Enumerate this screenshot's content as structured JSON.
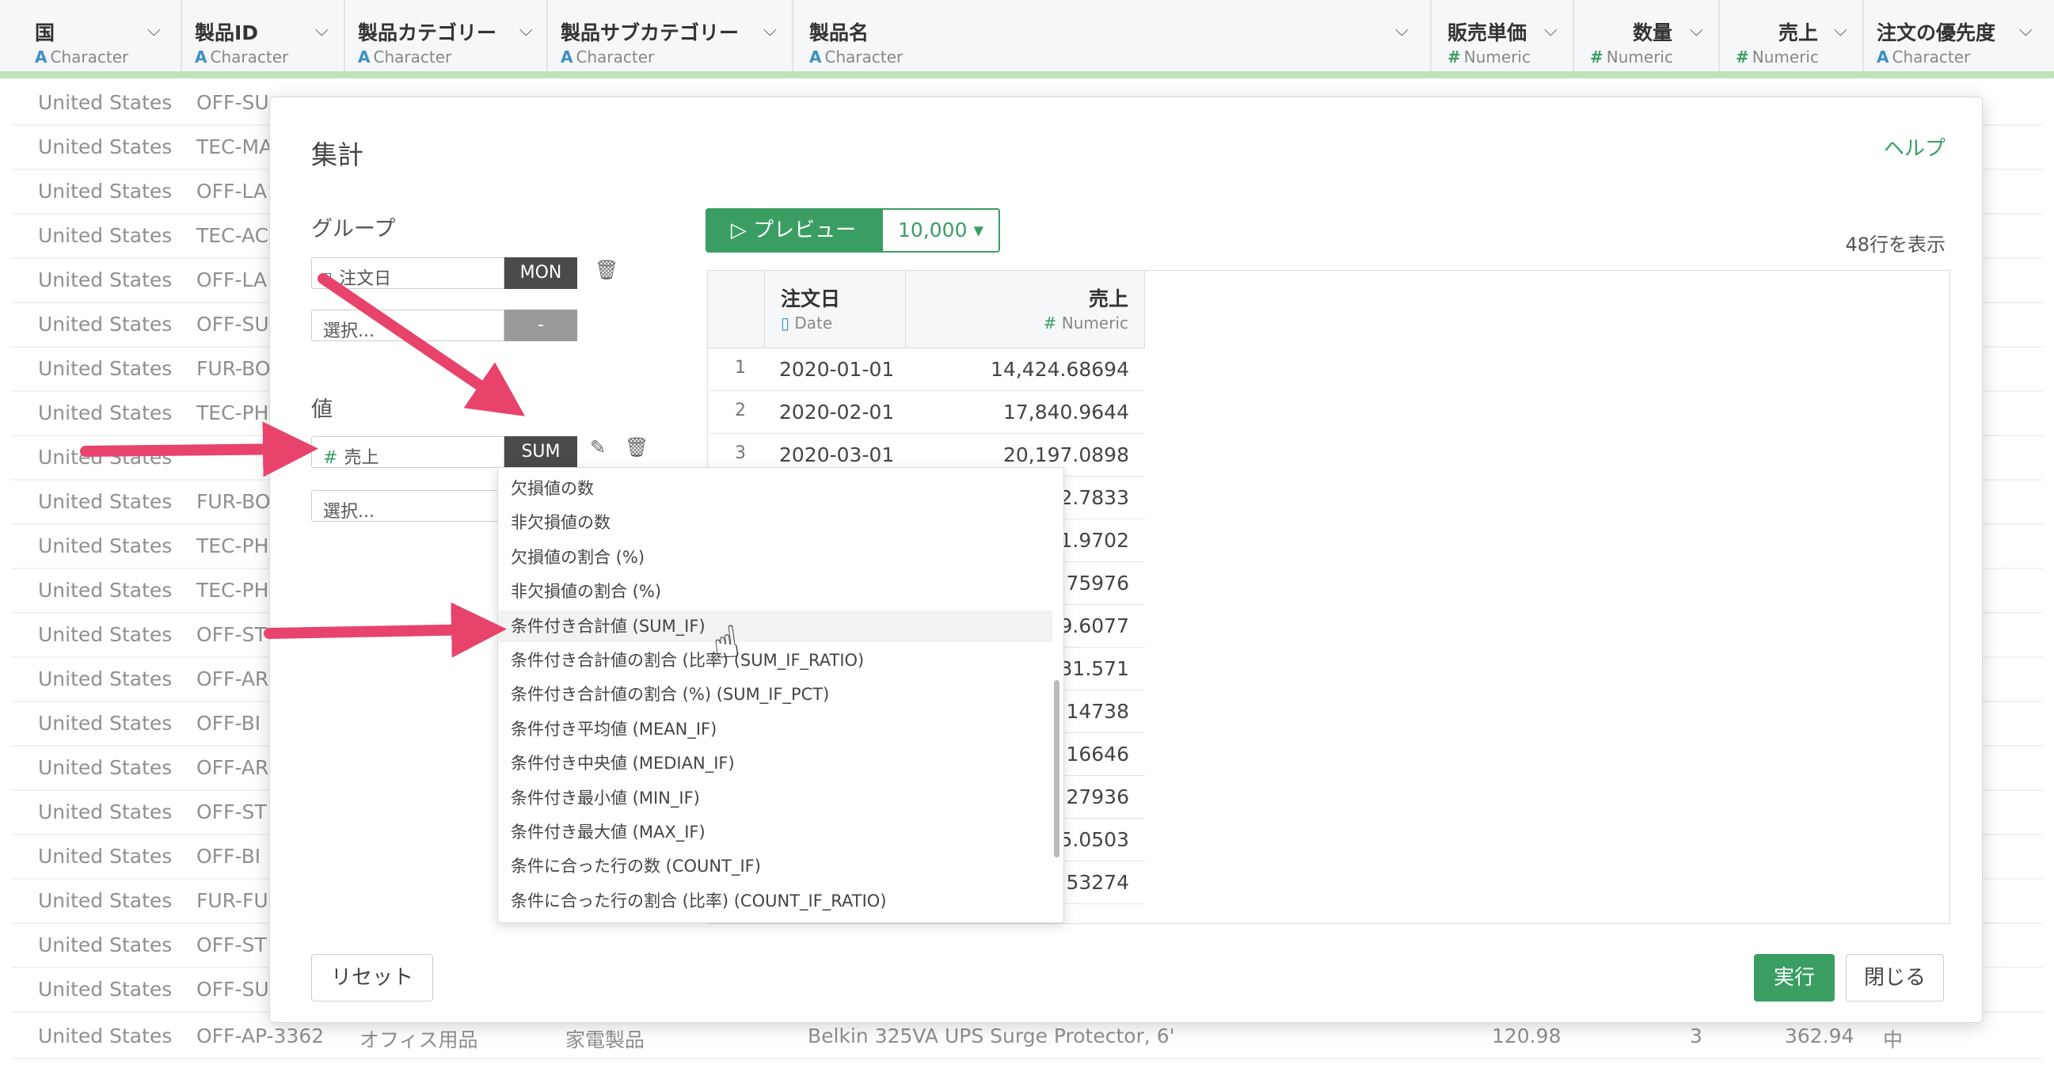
{
  "columns": [
    {
      "name": "国",
      "type": "Character"
    },
    {
      "name": "製品ID",
      "type": "Character"
    },
    {
      "name": "製品カテゴリー",
      "type": "Character"
    },
    {
      "name": "製品サブカテゴリー",
      "type": "Character"
    },
    {
      "name": "製品名",
      "type": "Character"
    },
    {
      "name": "販売単価",
      "type": "Numeric"
    },
    {
      "name": "数量",
      "type": "Numeric"
    },
    {
      "name": "売上",
      "type": "Numeric"
    },
    {
      "name": "注文の優先度",
      "type": "Character"
    }
  ],
  "rows": [
    {
      "country": "United States",
      "pid": "OFF-SU"
    },
    {
      "country": "United States",
      "pid": "TEC-MA"
    },
    {
      "country": "United States",
      "pid": "OFF-LA"
    },
    {
      "country": "United States",
      "pid": "TEC-AC"
    },
    {
      "country": "United States",
      "pid": "OFF-LA"
    },
    {
      "country": "United States",
      "pid": "OFF-SU"
    },
    {
      "country": "United States",
      "pid": "FUR-BO"
    },
    {
      "country": "United States",
      "pid": "TEC-PH"
    },
    {
      "country": "United States",
      "pid": ""
    },
    {
      "country": "United States",
      "pid": "FUR-BO"
    },
    {
      "country": "United States",
      "pid": "TEC-PH"
    },
    {
      "country": "United States",
      "pid": "TEC-PH"
    },
    {
      "country": "United States",
      "pid": "OFF-ST"
    },
    {
      "country": "United States",
      "pid": "OFF-AR"
    },
    {
      "country": "United States",
      "pid": "OFF-BI"
    },
    {
      "country": "United States",
      "pid": "OFF-AR"
    },
    {
      "country": "United States",
      "pid": "OFF-ST"
    },
    {
      "country": "United States",
      "pid": "OFF-BI"
    },
    {
      "country": "United States",
      "pid": "FUR-FU"
    },
    {
      "country": "United States",
      "pid": "OFF-ST"
    },
    {
      "country": "United States",
      "pid": "OFF-SU"
    }
  ],
  "last_row": {
    "country": "United States",
    "pid": "OFF-AP-3362",
    "category": "オフィス用品",
    "subcategory": "家電製品",
    "name": "Belkin 325VA UPS Surge Protector, 6'",
    "price": "120.98",
    "qty": "3",
    "sales": "362.94",
    "priority": "中"
  },
  "modal": {
    "title": "集計",
    "help": "ヘルプ",
    "group_label": "グループ",
    "group_field": "注文日",
    "group_fn": "MON",
    "group_select_placeholder": "選択...",
    "group_select_fn": "-",
    "value_label": "値",
    "value_field": "売上",
    "value_fn": "SUM",
    "value_select_placeholder": "選択...",
    "preview_label": "プレビュー",
    "preview_count": "10,000",
    "row_count": "48行を表示",
    "reset": "リセット",
    "run": "実行",
    "close": "閉じる"
  },
  "preview": {
    "col1": {
      "name": "注文日",
      "type": "Date"
    },
    "col2": {
      "name": "売上",
      "type": "Numeric"
    },
    "rows": [
      {
        "n": "1",
        "date": "2020-01-01",
        "sales": "14,424.68694"
      },
      {
        "n": "2",
        "date": "2020-02-01",
        "sales": "17,840.9644"
      },
      {
        "n": "3",
        "date": "2020-03-01",
        "sales": "20,197.0898"
      }
    ],
    "partial_values": [
      "2.7833",
      "1.9702",
      "75976",
      "9.6077",
      "31.571",
      "14738",
      "16646",
      "27936",
      "5.0503",
      "53274"
    ]
  },
  "dropdown": {
    "items": [
      "欠損値の数",
      "非欠損値の数",
      "欠損値の割合 (%)",
      "非欠損値の割合 (%)",
      "条件付き合計値 (SUM_IF)",
      "条件付き合計値の割合 (比率) (SUM_IF_RATIO)",
      "条件付き合計値の割合 (%) (SUM_IF_PCT)",
      "条件付き平均値 (MEAN_IF)",
      "条件付き中央値 (MEDIAN_IF)",
      "条件付き最小値 (MIN_IF)",
      "条件付き最大値 (MAX_IF)",
      "条件に合った行の数 (COUNT_IF)",
      "条件に合った行の割合 (比率) (COUNT_IF_RATIO)"
    ],
    "highlighted_index": 4
  },
  "colors": {
    "accent": "#3a9e63",
    "arrow": "#e8436b",
    "header_bar": "#bfe3b8"
  }
}
